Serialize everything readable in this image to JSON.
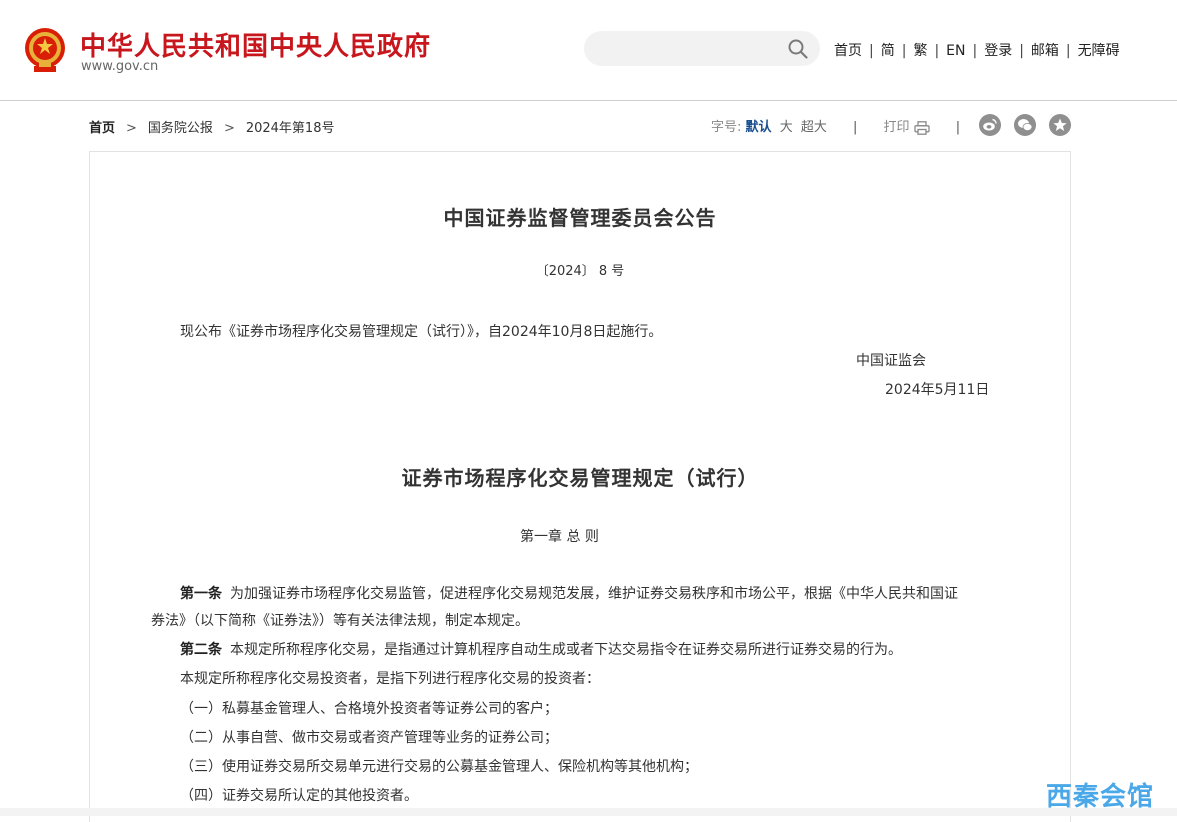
{
  "header": {
    "site_title": "中华人民共和国中央人民政府",
    "site_url": "www.gov.cn",
    "search_placeholder": "",
    "nav": [
      "首页",
      "简",
      "繁",
      "EN",
      "登录",
      "邮箱",
      "无障碍"
    ],
    "nav_separator": "|"
  },
  "breadcrumb": {
    "items": [
      "首页",
      "国务院公报",
      "2024年第18号"
    ],
    "arrow": ">"
  },
  "tools": {
    "font_label": "字号:",
    "font_default": "默认",
    "font_large": "大",
    "font_xlarge": "超大",
    "separator": "|",
    "print_label": "打印"
  },
  "article": {
    "notice_title": "中国证券监督管理委员会公告",
    "notice_number": "〔2024〕 8 号",
    "notice_body": "现公布《证券市场程序化交易管理规定（试行）》，自2024年10月8日起施行。",
    "issuer": "中国证监会",
    "issue_date": "2024年5月11日",
    "reg_title": "证券市场程序化交易管理规定（试行）",
    "chapter": "第一章 总 则",
    "art1_label": "第一条",
    "art1_line1": "为加强证券市场程序化交易监管，促进程序化交易规范发展，维护证券交易秩序和市场公平，根据《中华人民共和国证",
    "art1_line2": "券法》（以下简称《证券法》）等有关法律法规，制定本规定。",
    "art2_label": "第二条",
    "art2_text": "本规定所称程序化交易，是指通过计算机程序自动生成或者下达交易指令在证券交易所进行证券交易的行为。",
    "para_investors": "本规定所称程序化交易投资者，是指下列进行程序化交易的投资者：",
    "item1": "（一）私募基金管理人、合格境外投资者等证券公司的客户；",
    "item2": "（二）从事自营、做市交易或者资产管理等业务的证券公司；",
    "item3": "（三）使用证券交易所交易单元进行交易的公募基金管理人、保险机构等其他机构；",
    "item4": "（四）证券交易所认定的其他投资者。"
  },
  "watermark": "西秦会馆",
  "colors": {
    "brand_red": "#c8161d",
    "link_blue": "#1a4f8f",
    "watermark_blue": "#4aa8e8",
    "share_gray": "#8f8f8f"
  },
  "icons": [
    "national-emblem-icon",
    "search-icon",
    "print-icon",
    "weibo-icon",
    "wechat-icon",
    "favorite-icon"
  ]
}
